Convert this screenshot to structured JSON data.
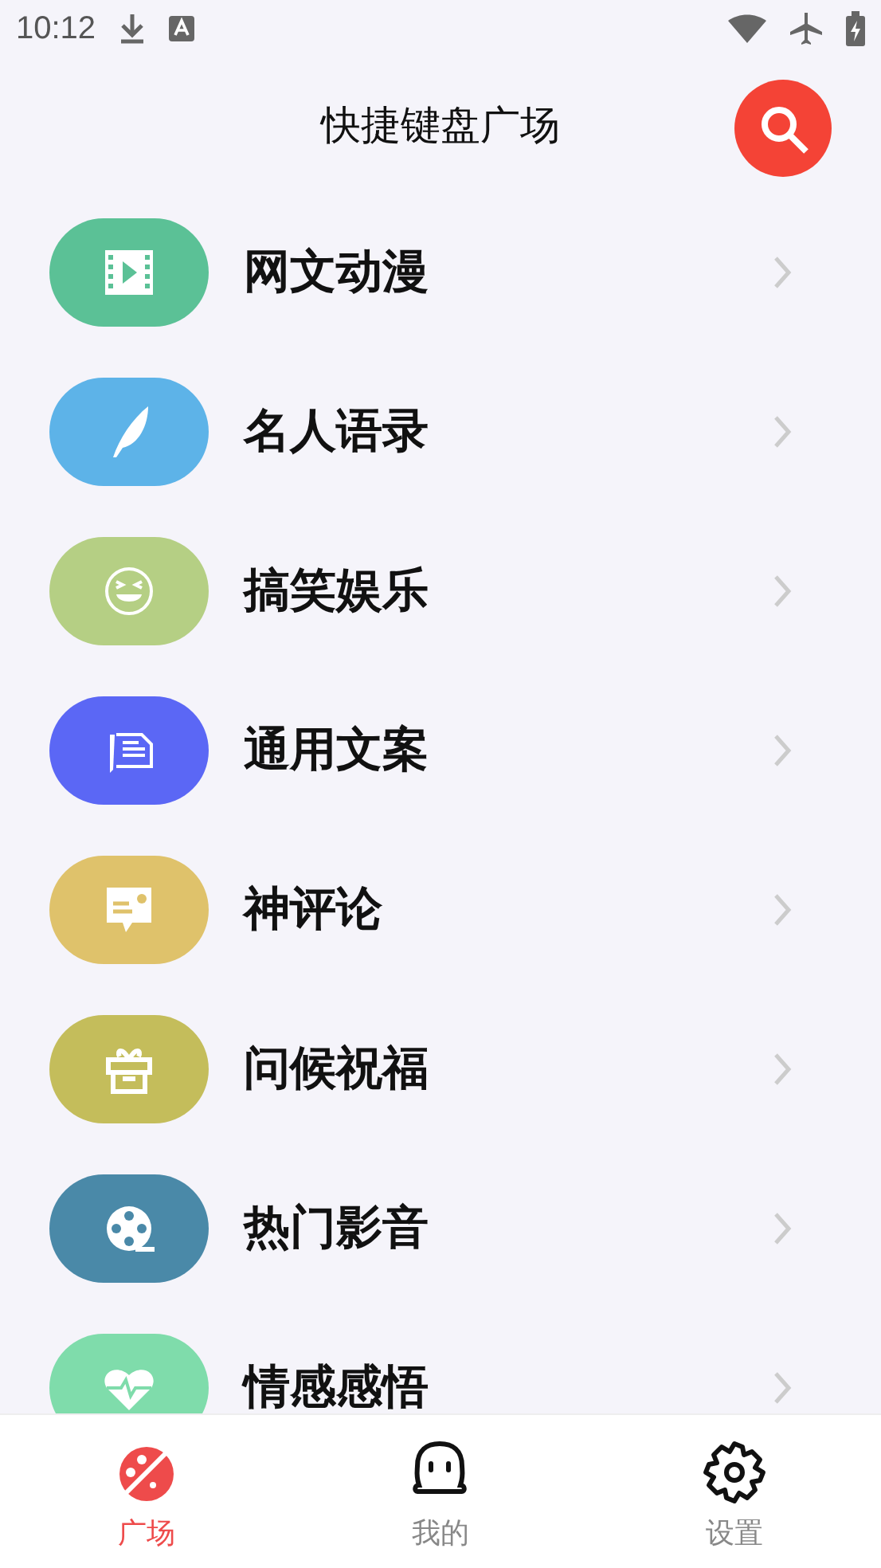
{
  "status_bar": {
    "time": "10:12"
  },
  "header": {
    "title": "快捷键盘广场"
  },
  "categories": [
    {
      "label": "网文动漫",
      "kind": "film",
      "color": "#5bc196"
    },
    {
      "label": "名人语录",
      "kind": "feather",
      "color": "#5db3e8"
    },
    {
      "label": "搞笑娱乐",
      "kind": "laugh",
      "color": "#b5cf84"
    },
    {
      "label": "通用文案",
      "kind": "document",
      "color": "#5b67f5"
    },
    {
      "label": "神评论",
      "kind": "comment",
      "color": "#dfc26b"
    },
    {
      "label": "问候祝福",
      "kind": "gift",
      "color": "#c4bd5b"
    },
    {
      "label": "热门影音",
      "kind": "reel",
      "color": "#4a89a8"
    },
    {
      "label": "情感感悟",
      "kind": "heart",
      "color": "#7fdcab"
    }
  ],
  "tabs": [
    {
      "label": "广场",
      "kind": "planet",
      "selected": true
    },
    {
      "label": "我的",
      "kind": "ghost",
      "selected": false
    },
    {
      "label": "设置",
      "kind": "gear",
      "selected": false
    }
  ]
}
